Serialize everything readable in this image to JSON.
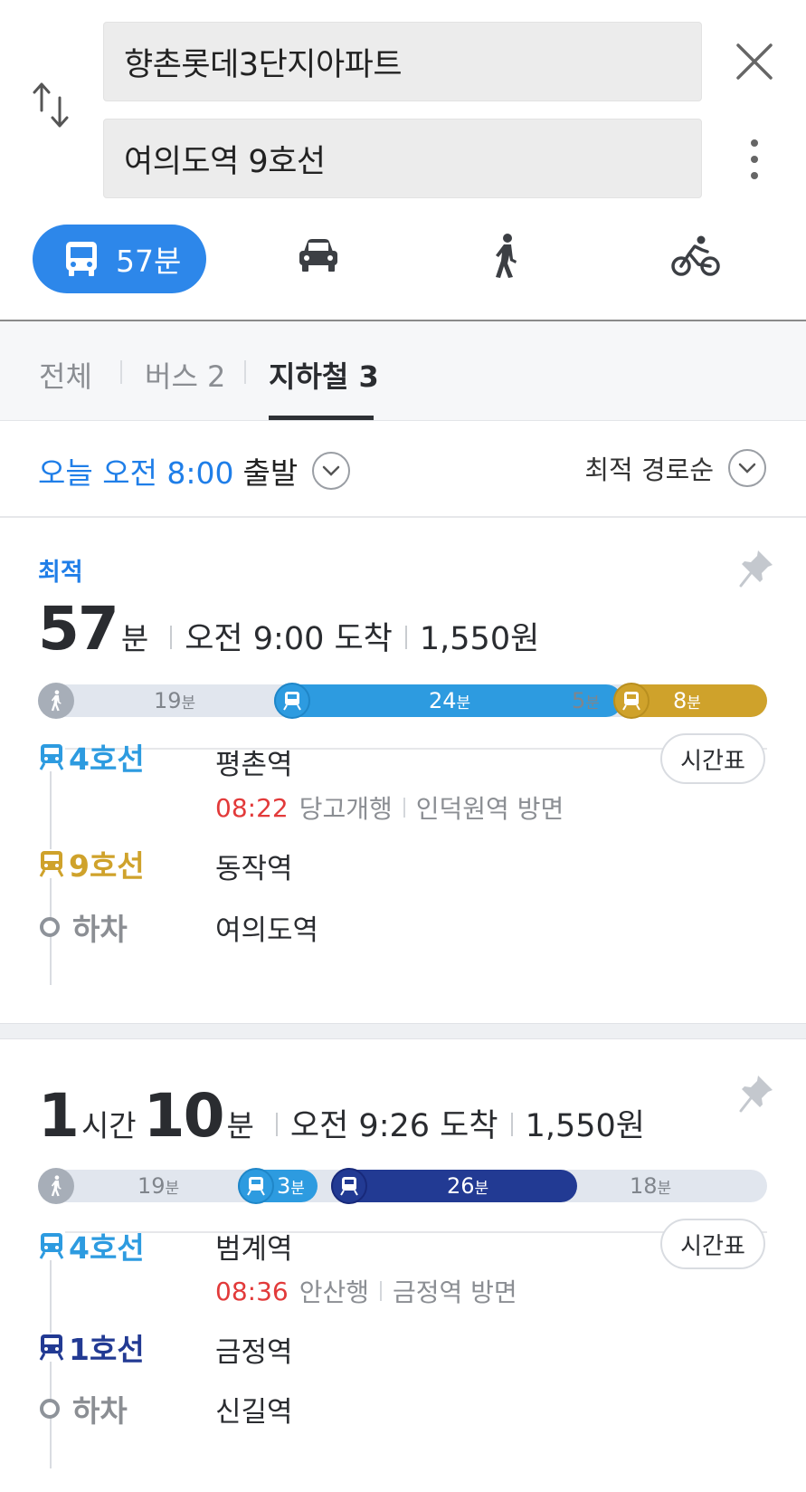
{
  "search": {
    "origin": "향촌롯데3단지아파트",
    "destination": "여의도역 9호선"
  },
  "modes": {
    "bus_label": "57분",
    "icons": [
      "bus-icon",
      "car-icon",
      "walk-icon",
      "bike-icon"
    ]
  },
  "filters": [
    {
      "label": "전체",
      "active": false
    },
    {
      "label": "버스 2",
      "active": false
    },
    {
      "label": "지하철 3",
      "active": true
    }
  ],
  "departure": {
    "time_text": "오늘 오전 8:00",
    "suffix": "출발",
    "sort_label": "최적 경로순"
  },
  "colors": {
    "accent": "#2d87ea",
    "line4": "#2d9be0",
    "line9": "#cfa22b",
    "line1": "#223a93",
    "walk": "#a7aeb8",
    "time_red": "#e23a3a"
  },
  "routes": [
    {
      "tag": "최적",
      "duration_value": "57",
      "duration_unit": "분",
      "arrival": "오전 9:00 도착",
      "fare": "1,550원",
      "bar": [
        {
          "type": "walk",
          "value": "19",
          "unit": "분"
        },
        {
          "type": "line4",
          "value": "24",
          "unit": "분"
        },
        {
          "type": "walk",
          "value": "5",
          "unit": "분"
        },
        {
          "type": "line9",
          "value": "8",
          "unit": "분"
        }
      ],
      "steps": [
        {
          "line": "4호선",
          "station": "평촌역",
          "time": "08:22",
          "direction": "당고개행",
          "platform": "인덕원역 방면",
          "timetable": "시간표"
        },
        {
          "line": "9호선",
          "station": "동작역"
        },
        {
          "line": "하차",
          "station": "여의도역"
        }
      ]
    },
    {
      "duration_hours": "1",
      "hours_unit": "시간",
      "duration_value": "10",
      "duration_unit": "분",
      "arrival": "오전 9:26 도착",
      "fare": "1,550원",
      "bar": [
        {
          "type": "walk",
          "value": "19",
          "unit": "분"
        },
        {
          "type": "line4",
          "value": "3",
          "unit": "분"
        },
        {
          "type": "line1",
          "value": "26",
          "unit": "분"
        },
        {
          "type": "walk",
          "value": "18",
          "unit": "분"
        }
      ],
      "steps": [
        {
          "line": "4호선",
          "station": "범계역",
          "time": "08:36",
          "direction": "안산행",
          "platform": "금정역 방면",
          "timetable": "시간표"
        },
        {
          "line": "1호선",
          "station": "금정역"
        },
        {
          "line": "하차",
          "station": "신길역"
        }
      ]
    }
  ]
}
